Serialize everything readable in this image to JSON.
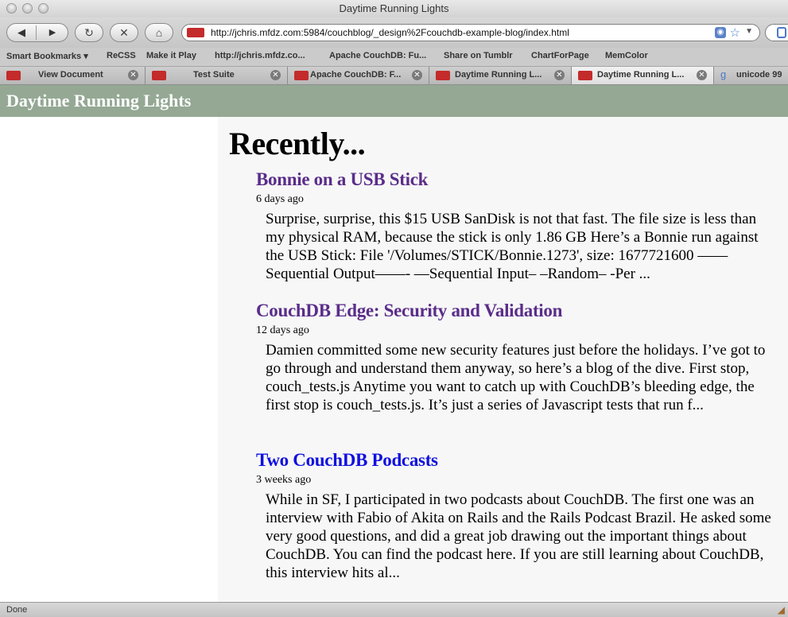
{
  "window": {
    "title": "Daytime Running Lights"
  },
  "toolbar": {
    "back_glyph": "◀",
    "forward_glyph": "▶",
    "reload_glyph": "↻",
    "stop_glyph": "✕",
    "home_glyph": "⌂",
    "url": "http://jchris.mfdz.com:5984/couchblog/_design%2Fcouchdb-example-blog/index.html",
    "rss_glyph": "◉",
    "star_glyph": "☆",
    "dropdown_glyph": "▼"
  },
  "bookmarks": [
    {
      "label": "Smart Bookmarks ▾"
    },
    {
      "label": "ReCSS"
    },
    {
      "label": "Make it Play"
    },
    {
      "label": "http://jchris.mfdz.co..."
    },
    {
      "label": "Apache CouchDB: Fu..."
    },
    {
      "label": "Share on Tumblr"
    },
    {
      "label": "ChartForPage"
    },
    {
      "label": "MemColor"
    }
  ],
  "tabs": [
    {
      "label": "View Document",
      "close": "✕"
    },
    {
      "label": "Test Suite",
      "close": "✕"
    },
    {
      "label": "Apache CouchDB: F...",
      "close": "✕"
    },
    {
      "label": "Daytime Running L...",
      "close": "✕"
    },
    {
      "label": "Daytime Running L...",
      "close": "✕"
    },
    {
      "label": "unicode 99",
      "close": ""
    }
  ],
  "page": {
    "site_title": "Daytime Running Lights",
    "heading": "Recently...",
    "posts": [
      {
        "title": "Bonnie on a USB Stick",
        "date": "6 days ago",
        "excerpt": "Surprise, surprise, this $15 USB SanDisk is not that fast. The file size is less than my physical RAM, because the stick is only 1.86 GB Here’s a Bonnie run against the USB Stick: File '/Volumes/STICK/Bonnie.1273', size: 1677721600 ——Sequential Output——- —Sequential Input– –Random– -Per ..."
      },
      {
        "title": "CouchDB Edge: Security and Validation",
        "date": "12 days ago",
        "excerpt": "Damien committed some new security features just before the holidays. I’ve got to go through and understand them anyway, so here’s a blog of the dive. First stop, couch_tests.js Anytime you want to catch up with CouchDB’s bleeding edge, the first stop is couch_tests.js. It’s just a series of Javascript tests that run f..."
      },
      {
        "title": "Two CouchDB Podcasts",
        "date": "3 weeks ago",
        "excerpt": "While in SF, I participated in two podcasts about CouchDB. The first one was an interview with Fabio of Akita on Rails and the Rails Podcast Brazil. He asked some very good questions, and did a great job drawing out the important things about CouchDB. You can find the podcast here. If you are still learning about CouchDB, this interview hits al..."
      }
    ]
  },
  "status": {
    "text": "Done"
  },
  "colors": {
    "header": "#94a894",
    "visited_link": "#5a2d8a",
    "unvisited_link": "#1010e0"
  }
}
